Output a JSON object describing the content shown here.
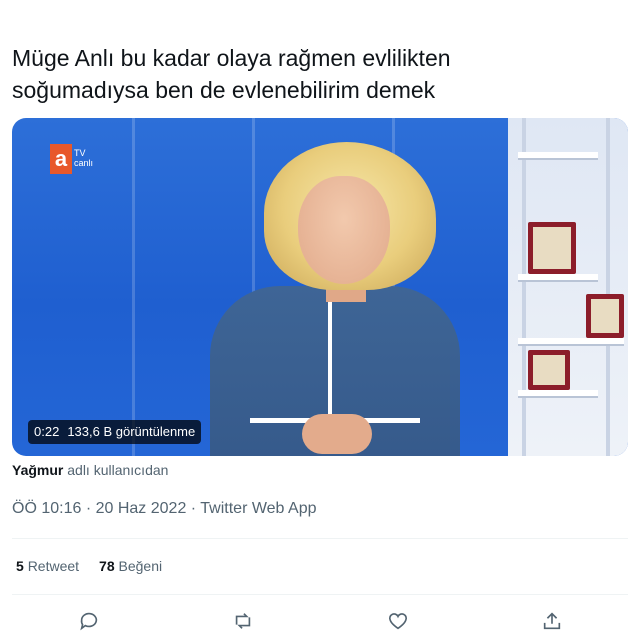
{
  "tweet": {
    "text_line1": "Müge Anlı bu kadar olaya rağmen evlilikten",
    "text_line2": "soğumadıysa ben de evlenebilirim demek"
  },
  "video": {
    "channel_logo_letter": "a",
    "channel_logo_tv": "TV",
    "channel_logo_live": "canlı",
    "duration": "0:22",
    "views": "133,6 B görüntülenme"
  },
  "attribution": {
    "user": "Yağmur",
    "suffix": "adlı kullanıcıdan"
  },
  "meta": {
    "time": "ÖÖ 10:16",
    "date": "20 Haz 2022",
    "source": "Twitter Web App",
    "separator": "·"
  },
  "stats": {
    "retweet_count": "5",
    "retweet_label": "Retweet",
    "like_count": "78",
    "like_label": "Beğeni"
  },
  "actions": {
    "icons": [
      "reply-icon",
      "retweet-icon",
      "like-icon",
      "share-icon"
    ],
    "icon_color": "#536471"
  }
}
